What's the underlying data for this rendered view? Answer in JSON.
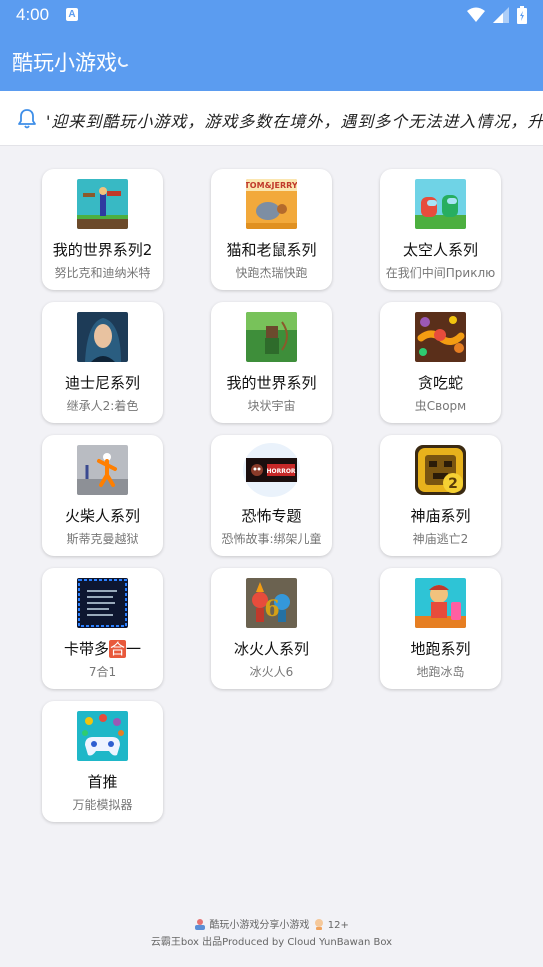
{
  "status": {
    "time": "4:00",
    "a_badge": "A"
  },
  "app": {
    "title": "酷玩小游戏"
  },
  "notice": {
    "text": "'迎来到酷玩小游戏，游戏多数在境外，遇到多个无法进入情况，升级更新"
  },
  "games": [
    {
      "name": "我的世界系列2",
      "sub": "努比克和迪纳米特",
      "icon": "minecraft-stick-icon"
    },
    {
      "name": "猫和老鼠系列",
      "sub": "快跑杰瑞快跑",
      "icon": "tom-jerry-icon"
    },
    {
      "name": "太空人系列",
      "sub": "在我们中间Приклю",
      "icon": "among-us-icon"
    },
    {
      "name": "迪士尼系列",
      "sub": "继承人2:着色",
      "icon": "disney-portrait-icon"
    },
    {
      "name": "我的世界系列",
      "sub": "块状宇宙",
      "icon": "minecraft-archer-icon"
    },
    {
      "name": "贪吃蛇",
      "sub": "虫Сворм",
      "icon": "snake-icon"
    },
    {
      "name": "火柴人系列",
      "sub": "斯蒂克曼越狱",
      "icon": "stickman-icon"
    },
    {
      "name": "恐怖专题",
      "sub": "恐怖故事:绑架儿童",
      "icon": "horror-icon"
    },
    {
      "name": "神庙系列",
      "sub": "神庙逃亡2",
      "icon": "temple-run-icon"
    },
    {
      "name": "卡带多",
      "name_badge": "合",
      "name_tail": "一",
      "sub": "7合1",
      "icon": "cartridge-icon"
    },
    {
      "name": "冰火人系列",
      "sub": "冰火人6",
      "icon": "fireboy-watergirl-icon"
    },
    {
      "name": "地跑系列",
      "sub": "地跑冰岛",
      "icon": "subway-surfers-icon"
    },
    {
      "name": "首推",
      "sub": "万能模拟器",
      "icon": "emulator-icon"
    }
  ],
  "footer": {
    "line1": "酷玩小游戏分享小游戏",
    "age": "12+",
    "line2": "云霸王box 出品Produced by Cloud YunBawan Box"
  }
}
